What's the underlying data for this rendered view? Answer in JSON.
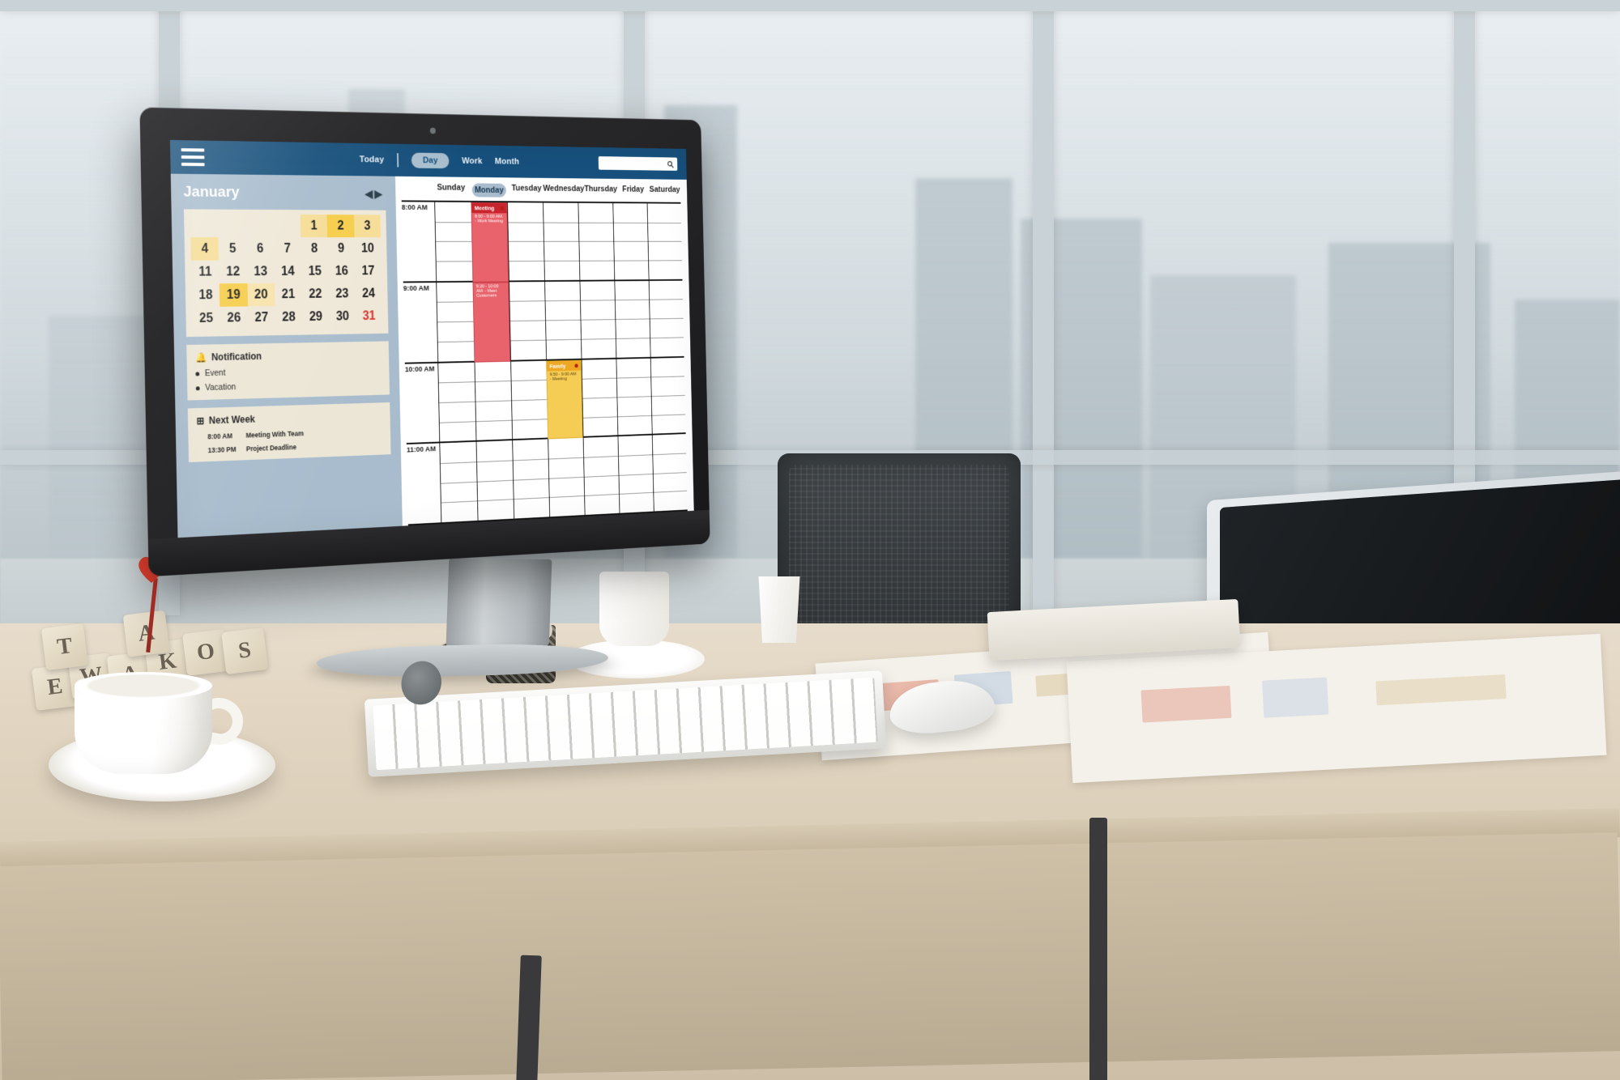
{
  "app": {
    "topbar": {
      "menu_icon": "hamburger-menu-icon",
      "today_label": "Today",
      "day_label": "Day",
      "work_label": "Work",
      "month_label": "Month",
      "search_placeholder": "",
      "search_value": "",
      "search_icon": "search-icon",
      "bg_color": "#17507c"
    },
    "sidebar": {
      "month_title": "January",
      "prev_icon": "caret-left-icon",
      "next_icon": "caret-right-icon",
      "prev_glyph": "◀",
      "next_glyph": "▶",
      "mini_calendar": {
        "leading_blanks": 4,
        "days": [
          1,
          2,
          3,
          4,
          5,
          6,
          7,
          8,
          9,
          10,
          11,
          12,
          13,
          14,
          15,
          16,
          17,
          18,
          19,
          20,
          21,
          22,
          23,
          24,
          25,
          26,
          27,
          28,
          29,
          30,
          31
        ],
        "highlight_light": [
          1,
          3,
          4
        ],
        "highlight_strong": [
          2,
          19
        ],
        "highlight_soft": [
          20
        ],
        "red_days": [
          31
        ],
        "bg_color": "#efe8d8",
        "accent_strong": "#f6cd4a",
        "accent_light": "#f6dd96"
      },
      "notification": {
        "icon": "bell-icon",
        "glyph": "🔔",
        "title": "Notification",
        "items": [
          "Event",
          "Vacation"
        ]
      },
      "next_week": {
        "icon": "plus-box-icon",
        "glyph": "⊞",
        "title": "Next Week",
        "rows": [
          {
            "time": "8:00 AM",
            "label": "Meeting  With Team"
          },
          {
            "time": "13:30 PM",
            "label": "Project Deadline"
          }
        ]
      },
      "bg_color": "#a8bccd"
    },
    "calendar": {
      "day_headers": [
        "Sunday",
        "Monday",
        "Tuesday",
        "Wednesday",
        "Thursday",
        "Friday",
        "Saturday"
      ],
      "active_day": "Monday",
      "hours": [
        "8:00 AM",
        "9:00 AM",
        "10:00 AM",
        "11:00 AM"
      ],
      "events": [
        {
          "title": "Meeting",
          "subtitle": "8:00 - 9:00 AM. - Work Meeting",
          "day": "Monday",
          "start": "8:00 AM",
          "end": "9:00 AM",
          "color": "#e8636b",
          "header_color": "#c7242c",
          "has_dot": true
        },
        {
          "title": "",
          "subtitle": "9:20 - 10:00 AM. - Meet Customers",
          "day": "Monday",
          "start": "9:00 AM",
          "end": "10:00 AM",
          "color": "#e8636b",
          "header_color": "#c7242c",
          "has_dot": false
        },
        {
          "title": "Family",
          "subtitle": "9:50 - 9:00 AM - Meeting",
          "day": "Wednesday",
          "start": "10:00 AM",
          "end": "11:00 AM",
          "color": "#f5cc54",
          "header_color": "#efa823",
          "has_dot": true
        }
      ]
    }
  },
  "scene": {
    "desk_blocks": [
      "E",
      "W",
      "A",
      "K",
      "O",
      "S",
      "T",
      "A"
    ]
  }
}
